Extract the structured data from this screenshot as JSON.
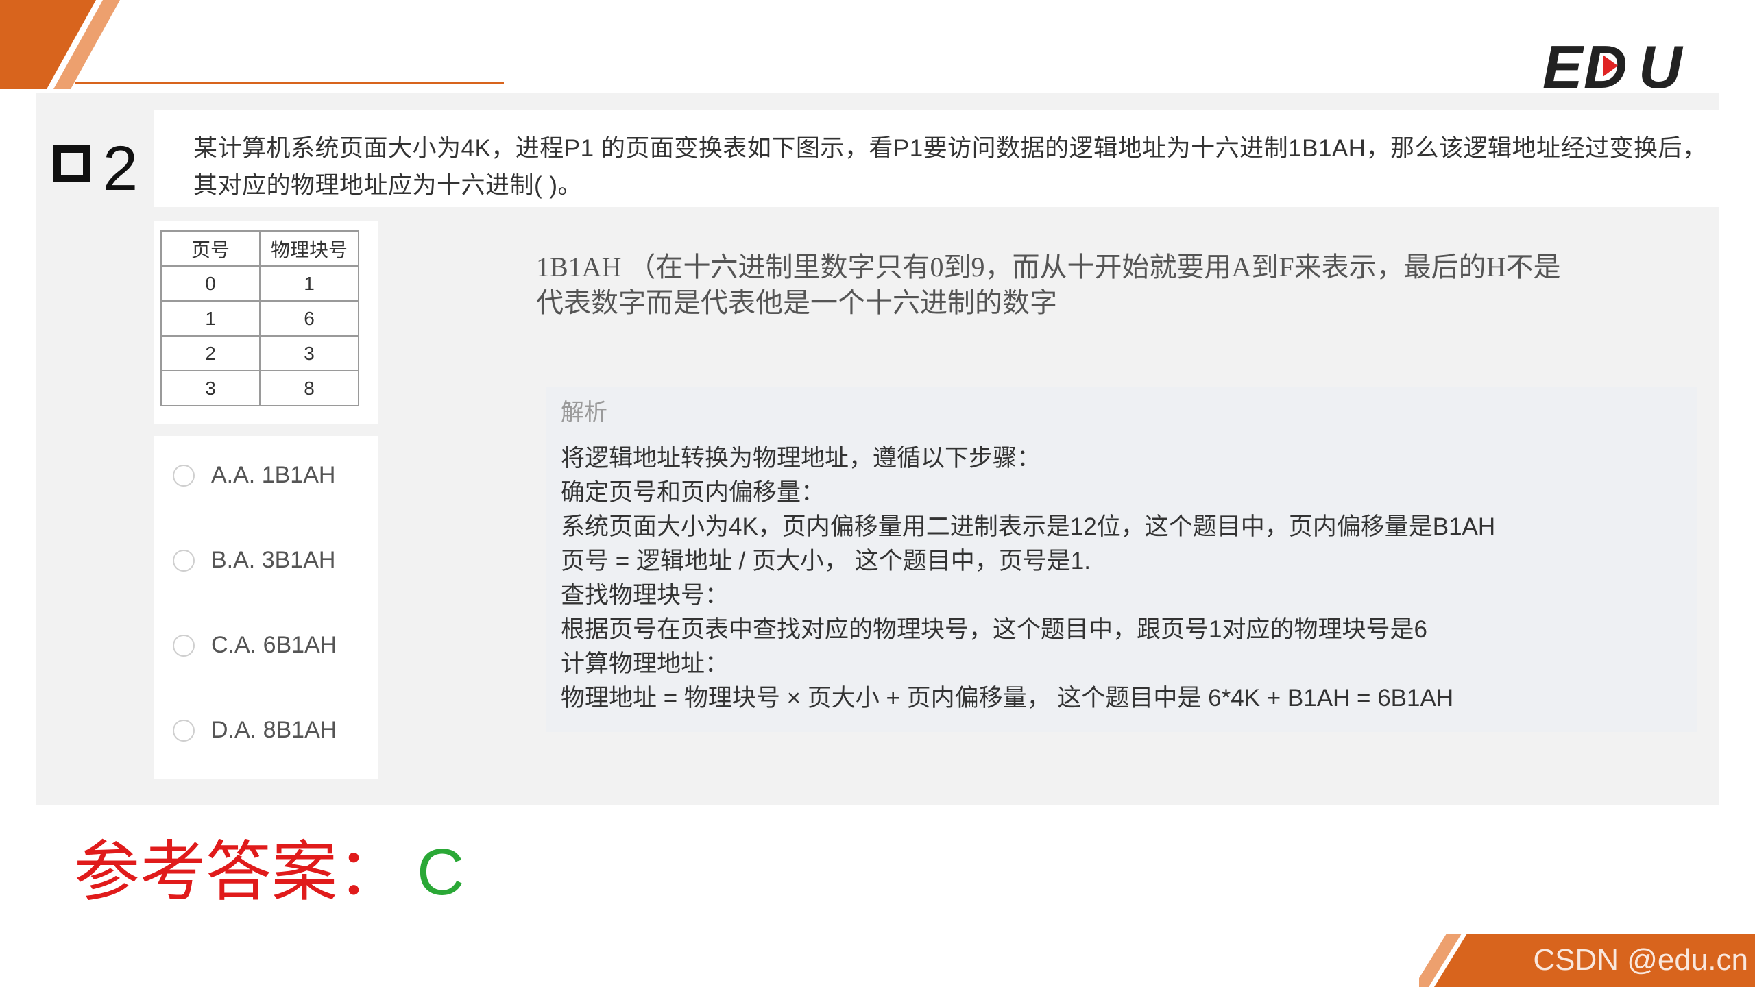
{
  "brand": {
    "logo_text": "EDU",
    "accent_color": "#d8641d",
    "logo_color": "#222222"
  },
  "question": {
    "number": "2",
    "text_line1": "某计算机系统页面大小为4K，进程P1 的页面变换表如下图示，看P1要访问数据的逻辑地址为十六进制1B1AH，那么该逻辑地址经过变换后，",
    "text_line2": "其对应的物理地址应为十六进制(    )。"
  },
  "page_table": {
    "headers": [
      "页号",
      "物理块号"
    ],
    "rows": [
      [
        "0",
        "1"
      ],
      [
        "1",
        "6"
      ],
      [
        "2",
        "3"
      ],
      [
        "3",
        "8"
      ]
    ]
  },
  "options": [
    {
      "label": "A.A. 1B1AH"
    },
    {
      "label": "B.A. 3B1AH"
    },
    {
      "label": "C.A. 6B1AH"
    },
    {
      "label": "D.A. 8B1AH"
    }
  ],
  "note": {
    "line1": "1B1AH （在十六进制里数字只有0到9，而从十开始就要用A到F来表示，最后的H不是",
    "line2": "代表数字而是代表他是一个十六进制的数字"
  },
  "analysis": {
    "title": "解析",
    "lines": [
      "将逻辑地址转换为物理地址，遵循以下步骤：",
      "确定页号和页内偏移量：",
      "系统页面大小为4K，页内偏移量用二进制表示是12位，这个题目中，页内偏移量是B1AH",
      "页号 = 逻辑地址 / 页大小， 这个题目中，页号是1.",
      "查找物理块号：",
      "根据页号在页表中查找对应的物理块号，这个题目中，跟页号1对应的物理块号是6",
      "计算物理地址：",
      "物理地址 = 物理块号 × 页大小 + 页内偏移量， 这个题目中是 6*4K + B1AH = 6B1AH"
    ]
  },
  "answer": {
    "label": "参考答案：",
    "value": "C"
  },
  "watermark": "CSDN @edu.cn"
}
